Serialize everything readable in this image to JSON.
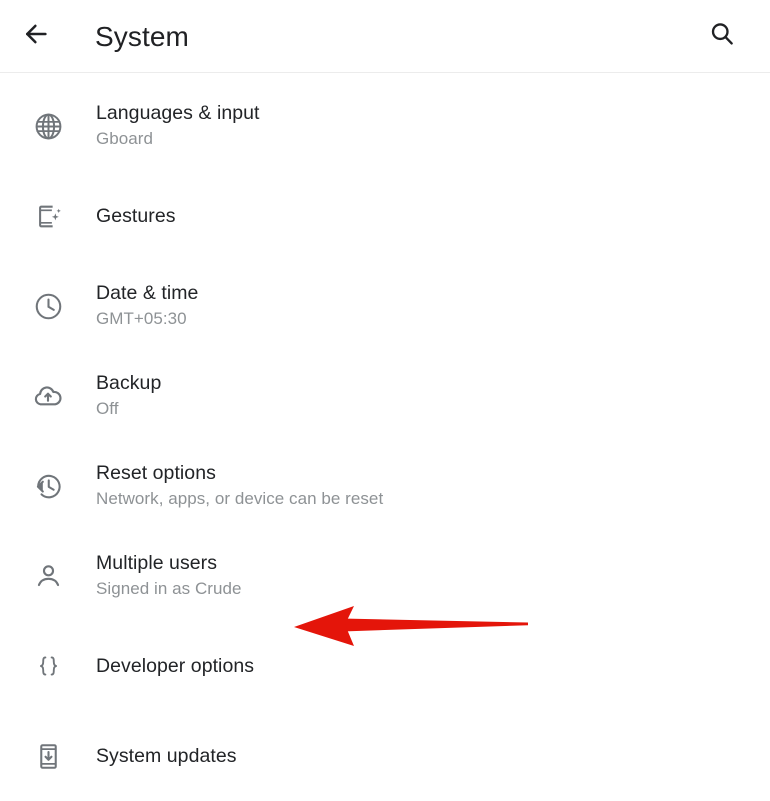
{
  "app_bar": {
    "back_icon": "arrow-left-icon",
    "title": "System",
    "search_icon": "search-icon"
  },
  "settings_list": {
    "items": [
      {
        "icon": "globe-icon",
        "title": "Languages & input",
        "subtitle": "Gboard"
      },
      {
        "icon": "gestures-phone-icon",
        "title": "Gestures",
        "subtitle": ""
      },
      {
        "icon": "clock-icon",
        "title": "Date & time",
        "subtitle": "GMT+05:30"
      },
      {
        "icon": "cloud-upload-icon",
        "title": "Backup",
        "subtitle": "Off"
      },
      {
        "icon": "history-restore-icon",
        "title": "Reset options",
        "subtitle": "Network, apps, or device can be reset"
      },
      {
        "icon": "person-icon",
        "title": "Multiple users",
        "subtitle": "Signed in as Crude"
      },
      {
        "icon": "curly-braces-icon",
        "title": "Developer options",
        "subtitle": ""
      },
      {
        "icon": "phone-download-icon",
        "title": "System updates",
        "subtitle": ""
      }
    ]
  },
  "annotation": {
    "type": "arrow-pointing-left",
    "target": "Developer options",
    "color": "#E4150A"
  },
  "colors": {
    "background": "#FFFFFF",
    "title_text": "#202124",
    "item_title_text": "#222427",
    "item_subtitle_text": "#8E9295",
    "icon": "#70757A",
    "divider": "#ECECEC",
    "annotation_red": "#E4150A"
  }
}
